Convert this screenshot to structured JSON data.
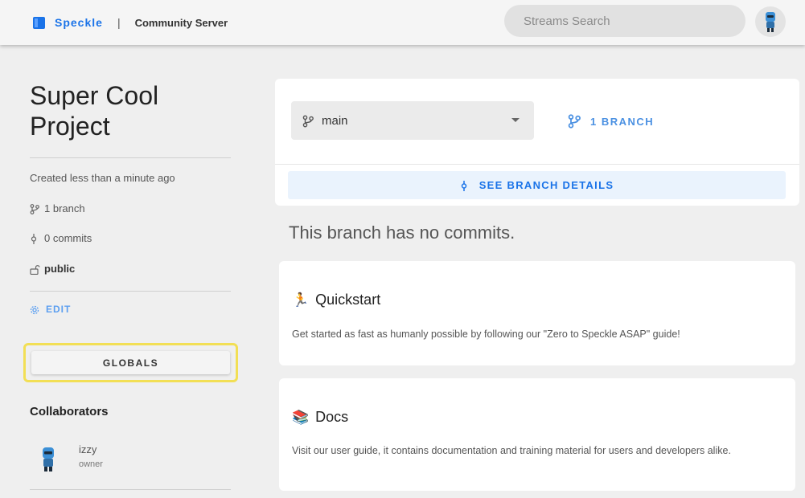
{
  "appbar": {
    "brand": "Speckle",
    "separator": "|",
    "server": "Community Server",
    "search_placeholder": "Streams Search"
  },
  "stream": {
    "title_line1": "Super Cool",
    "title_line2": "Project",
    "created": "Created less than a minute ago",
    "branches": "1 branch",
    "commits": "0 commits",
    "visibility": "public",
    "edit_label": "EDIT",
    "globals_label": "GLOBALS"
  },
  "collaborators": {
    "title": "Collaborators",
    "items": [
      {
        "name": "izzy",
        "role": "owner"
      }
    ]
  },
  "branch_card": {
    "selected_branch": "main",
    "branch_count_label": "1 BRANCH",
    "see_details_label": "SEE BRANCH DETAILS"
  },
  "empty_state": "This branch has no commits.",
  "cards": [
    {
      "emoji": "🏃",
      "title": "Quickstart",
      "text": "Get started as fast as humanly possible by following our \"Zero to Speckle ASAP\" guide!"
    },
    {
      "emoji": "📚",
      "title": "Docs",
      "text": "Visit our user guide, it contains documentation and training material for users and developers alike."
    }
  ],
  "colors": {
    "accent": "#1a73e8",
    "highlight": "#f2df55"
  }
}
